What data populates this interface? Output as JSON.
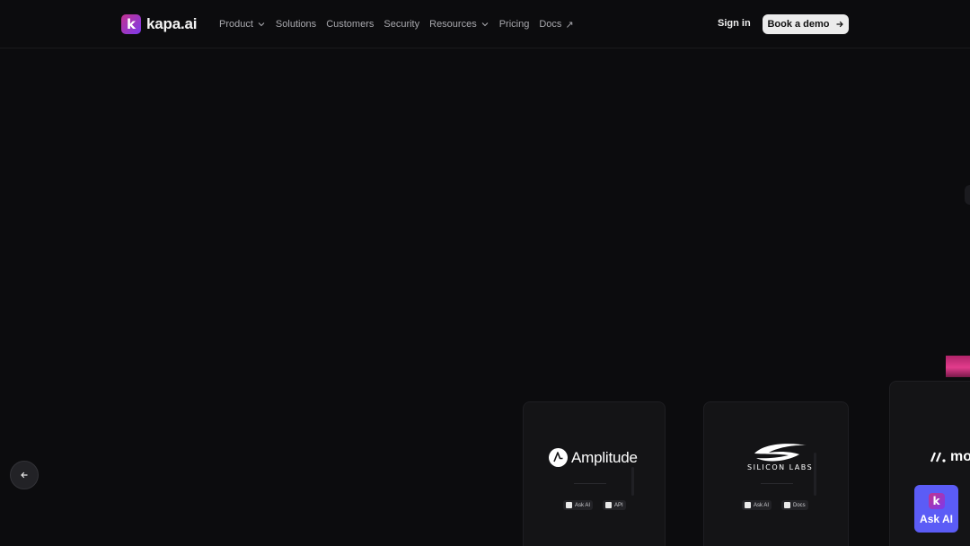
{
  "brand": {
    "name": "kapa.ai",
    "logo_letter": "k"
  },
  "nav": {
    "items": [
      {
        "label": "Product",
        "dropdown": true
      },
      {
        "label": "Solutions"
      },
      {
        "label": "Customers"
      },
      {
        "label": "Security"
      },
      {
        "label": "Resources",
        "dropdown": true
      },
      {
        "label": "Pricing"
      },
      {
        "label": "Docs",
        "external_glyph": "↗"
      }
    ],
    "sign_in": "Sign in",
    "book_demo": "Book a demo"
  },
  "carousel": {
    "cards": [
      {
        "company": "Amplitude",
        "chips": [
          "Ask AI",
          "API"
        ]
      },
      {
        "company": "SILICON LABS",
        "chips": [
          "Ask AI",
          "Docs"
        ]
      },
      {
        "company": "mo"
      }
    ]
  },
  "widget": {
    "label": "Ask AI",
    "logo_letter": "k"
  },
  "colors": {
    "background": "#0c0c0e",
    "card": "#141416",
    "accent_widget": "#5b5cf6",
    "pink_strip": "#e23c8c",
    "demo_button": "#ececec"
  }
}
